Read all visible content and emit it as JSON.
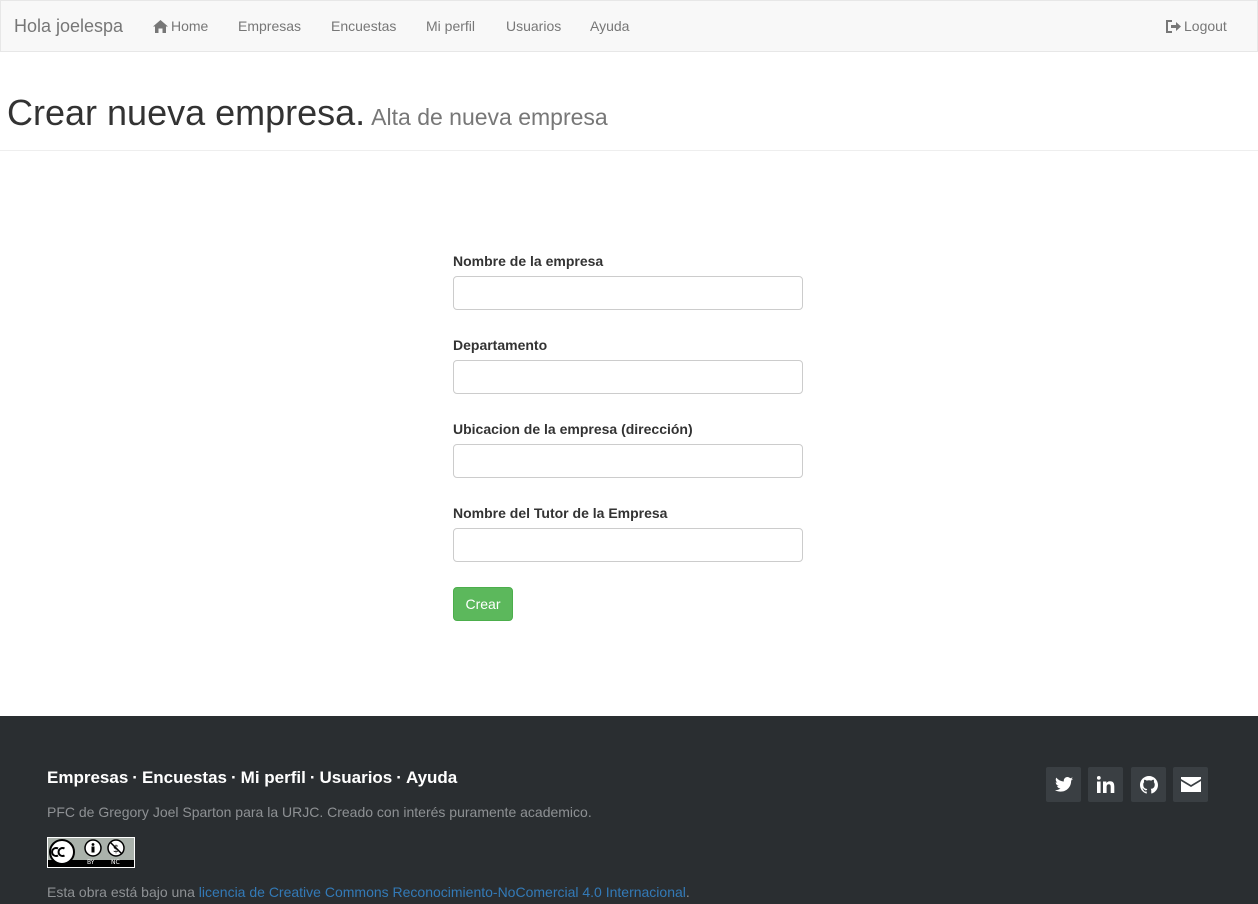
{
  "navbar": {
    "brand": "Hola joelespa",
    "items": [
      {
        "label": "Home",
        "icon": "home-icon"
      },
      {
        "label": "Empresas"
      },
      {
        "label": "Encuestas"
      },
      {
        "label": "Mi perfil"
      },
      {
        "label": "Usuarios"
      },
      {
        "label": "Ayuda"
      }
    ],
    "logout": {
      "label": "Logout",
      "icon": "logout-icon"
    }
  },
  "header": {
    "title": "Crear nueva empresa.",
    "subtitle": "Alta de nueva empresa"
  },
  "form": {
    "fields": [
      {
        "label": "Nombre de la empresa",
        "value": ""
      },
      {
        "label": "Departamento",
        "value": ""
      },
      {
        "label": "Ubicacion de la empresa (dirección)",
        "value": ""
      },
      {
        "label": "Nombre del Tutor de la Empresa",
        "value": ""
      }
    ],
    "submit_label": "Crear"
  },
  "footer": {
    "links": [
      "Empresas",
      "Encuestas",
      "Mi perfil",
      "Usuarios",
      "Ayuda"
    ],
    "separator": "·",
    "credit": "PFC de Gregory Joel Sparton para la URJC. Creado con interés puramente academico.",
    "license_prefix": "Esta obra está bajo una ",
    "license_link": "licencia de Creative Commons Reconocimiento-NoComercial 4.0 Internacional",
    "license_suffix": ".",
    "badge_text": {
      "by": "BY",
      "nc": "NC"
    },
    "social_icons": [
      "twitter-icon",
      "linkedin-icon",
      "github-icon",
      "envelope-icon"
    ]
  },
  "colors": {
    "navbar_bg": "#f8f8f8",
    "primary_button": "#5cb85c",
    "footer_bg": "#2a2e31",
    "link": "#337ab7"
  }
}
